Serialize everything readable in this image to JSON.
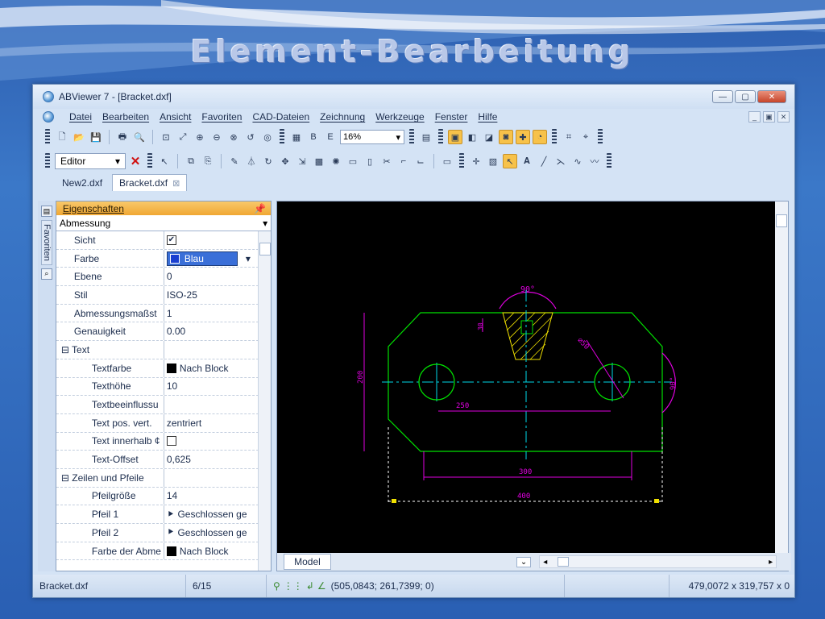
{
  "slide_title": "Element-Bearbeitung",
  "window": {
    "title": "ABViewer 7 - [Bracket.dxf]",
    "controls": [
      "minimize-icon",
      "maximize-icon",
      "close-icon"
    ]
  },
  "menu": [
    "Datei",
    "Bearbeiten",
    "Ansicht",
    "Favoriten",
    "CAD-Dateien",
    "Zeichnung",
    "Werkzeuge",
    "Fenster",
    "Hilfe"
  ],
  "toolbar": {
    "zoom_value": "16%",
    "editor_mode": "Editor"
  },
  "tabs": [
    {
      "label": "New2.dxf"
    },
    {
      "label": "Bracket.dxf"
    }
  ],
  "left_strip": {
    "label": "Favoriten"
  },
  "properties": {
    "header": "Eigenschaften",
    "category": "Abmessung",
    "rows": [
      {
        "name": "Sicht",
        "value": "",
        "kind": "check",
        "checked": true
      },
      {
        "name": "Farbe",
        "value": "Blau",
        "kind": "farbe"
      },
      {
        "name": "Ebene",
        "value": "0"
      },
      {
        "name": "Stil",
        "value": "ISO-25"
      },
      {
        "name": "Abmessungsmaßst",
        "value": "1"
      },
      {
        "name": "Genauigkeit",
        "value": "0.00"
      },
      {
        "name": "⊟ Text",
        "value": "",
        "kind": "group"
      },
      {
        "name": "Textfarbe",
        "value": "Nach Block",
        "kind": "swatch",
        "indent": true
      },
      {
        "name": "Texthöhe",
        "value": "10",
        "indent": true
      },
      {
        "name": "Textbeeinflussu",
        "value": "",
        "indent": true
      },
      {
        "name": "Text pos. vert.",
        "value": "zentriert",
        "indent": true
      },
      {
        "name": "Text innerhalb ¢",
        "value": "",
        "kind": "check",
        "checked": false,
        "indent": true
      },
      {
        "name": "Text-Offset",
        "value": "0,625",
        "indent": true
      },
      {
        "name": "⊟ Zeilen und Pfeile",
        "value": "",
        "kind": "group"
      },
      {
        "name": "Pfeilgröße",
        "value": "14",
        "indent": true
      },
      {
        "name": "Pfeil 1",
        "value": "Geschlossen ge",
        "kind": "arrow",
        "indent": true
      },
      {
        "name": "Pfeil 2",
        "value": "Geschlossen ge",
        "kind": "arrow",
        "indent": true
      },
      {
        "name": "Farbe der Abme",
        "value": "Nach Block",
        "kind": "swatch",
        "indent": true
      }
    ]
  },
  "drawing": {
    "dim_angle_top": "90°",
    "dim_30": "30",
    "dim_diam": "⌀50",
    "dim_200": "200",
    "dim_250": "250",
    "dim_90_right": "90°",
    "dim_300": "300",
    "dim_400": "400"
  },
  "canvas": {
    "model_tab": "Model"
  },
  "status": {
    "file": "Bracket.dxf",
    "page": "6/15",
    "coords": "(505,0843; 261,7399; 0)",
    "size": "479,0072 x 319,757 x 0"
  },
  "colors": {
    "green": "#00e000",
    "magenta": "#e000e0",
    "cyan": "#00d8e8",
    "yellow": "#f0e000",
    "white": "#ffffff"
  }
}
